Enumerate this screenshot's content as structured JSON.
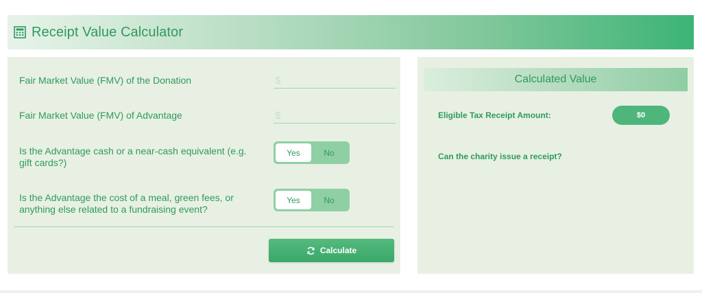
{
  "header": {
    "title": "Receipt Value Calculator",
    "icon": "calculator-icon"
  },
  "form": {
    "fmv_donation": {
      "label": "Fair Market Value (FMV) of the Donation",
      "prefix": "$",
      "value": ""
    },
    "fmv_advantage": {
      "label": "Fair Market Value (FMV) of Advantage",
      "prefix": "$",
      "value": ""
    },
    "cash_equivalent": {
      "label": "Is the Advantage cash or a near-cash equivalent (e.g. gift cards?)",
      "options": [
        "Yes",
        "No"
      ],
      "selected": "Yes"
    },
    "fundraising_event": {
      "label": "Is the Advantage the cost of a meal, green fees, or anything else related to a fundraising event?",
      "options": [
        "Yes",
        "No"
      ],
      "selected": "Yes"
    },
    "calculate_label": "Calculate",
    "calculate_icon": "refresh-icon"
  },
  "result": {
    "heading": "Calculated Value",
    "eligible_label": "Eligible Tax Receipt Amount:",
    "eligible_value": "$0",
    "receipt_question": "Can the charity issue a receipt?"
  },
  "colors": {
    "accent": "#3db476",
    "text": "#2e9a5e",
    "panel_bg": "#e8f0e3",
    "button": "#4fb67b"
  }
}
